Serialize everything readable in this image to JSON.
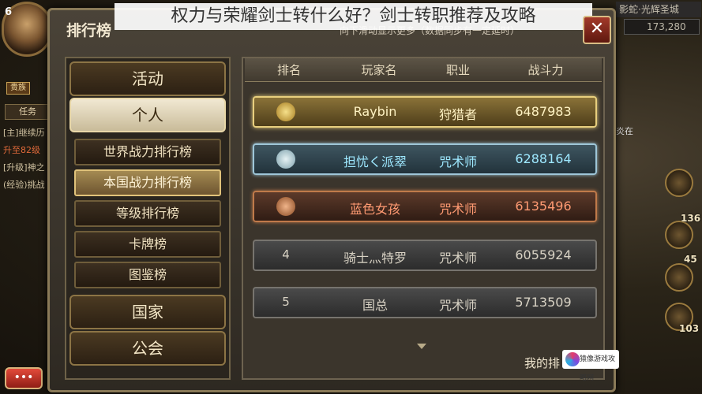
{
  "banner": {
    "title": "权力与荣耀剑士转什么好？剑士转职推荐及攻略"
  },
  "hud_left": {
    "level": "6",
    "rank_chip": "贵族",
    "task_tab": "任务",
    "quests": [
      "[主]继续历",
      "升至82级",
      "[升级]神之",
      "(经验)挑战"
    ]
  },
  "hud_right": {
    "location": "影蛇·光辉圣城",
    "coins": "173,280",
    "side_numbers": [
      "136",
      "45",
      "103"
    ],
    "hint": "炎在"
  },
  "panel": {
    "title": "排行榜",
    "sub_note": "向下滑动显示更多（数据同步有一定延时）",
    "close_label": "✕",
    "my_rank_label": "我的排"
  },
  "menu": {
    "categories": [
      {
        "label": "活动",
        "active": false
      },
      {
        "label": "个人",
        "active": true
      },
      {
        "label": "国家",
        "active": false
      },
      {
        "label": "公会",
        "active": false
      }
    ],
    "subitems": [
      {
        "label": "世界战力排行榜",
        "active": false
      },
      {
        "label": "本国战力排行榜",
        "active": true
      },
      {
        "label": "等级排行榜",
        "active": false
      },
      {
        "label": "卡牌榜",
        "active": false
      },
      {
        "label": "图鉴榜",
        "active": false
      }
    ]
  },
  "table": {
    "headers": [
      "排名",
      "玩家名",
      "职业",
      "战斗力"
    ],
    "rows": [
      {
        "rank": "",
        "medal": "gold",
        "name": "Raybin",
        "class": "狩猎者",
        "power": "6487983",
        "name_color": "#fff3c4",
        "class_color": "#fff3c4",
        "power_color": "#fff3c4"
      },
      {
        "rank": "",
        "medal": "silver",
        "name": "担忧く派翠",
        "class": "咒术师",
        "power": "6288164",
        "name_color": "#9ee8ff",
        "class_color": "#9ee8ff",
        "power_color": "#9ee8ff"
      },
      {
        "rank": "",
        "medal": "bronze",
        "name": "蓝色女孩",
        "class": "咒术师",
        "power": "6135496",
        "name_color": "#ff9a72",
        "class_color": "#ff9a72",
        "power_color": "#ff9a72"
      },
      {
        "rank": "4",
        "medal": "",
        "name": "骑士灬特罗",
        "class": "咒术师",
        "power": "6055924",
        "name_color": "#d8d2c4",
        "class_color": "#d8d2c4",
        "power_color": "#d8d2c4"
      },
      {
        "rank": "5",
        "medal": "",
        "name": "国总",
        "class": "咒术师",
        "power": "5713509",
        "name_color": "#d8d2c4",
        "class_color": "#d8d2c4",
        "power_color": "#d8d2c4"
      }
    ]
  },
  "chat_button": "•••",
  "watermark": "猿像游戏攻略网"
}
